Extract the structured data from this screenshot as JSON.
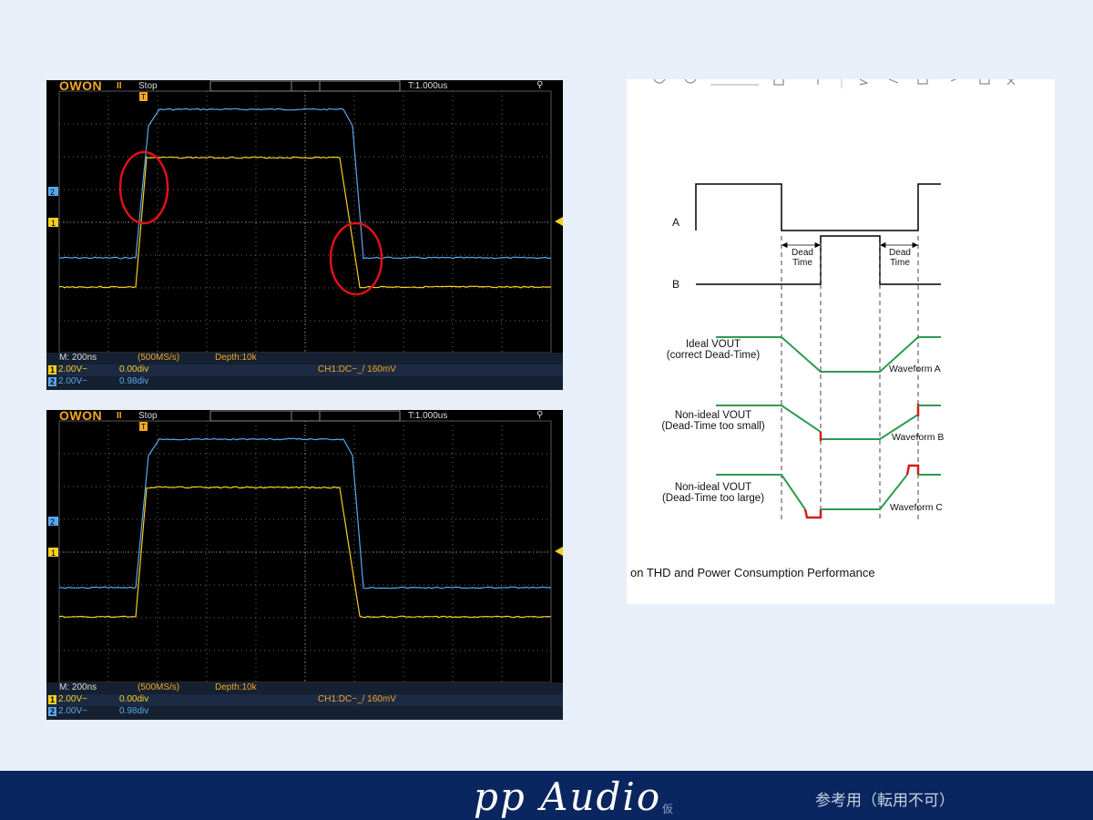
{
  "scopes": [
    {
      "brand": "OWON",
      "run_state": "Stop",
      "pause_glyph": "II",
      "trigger_time": "T:1.000us",
      "timebase": "M: 200ns",
      "sample_rate": "(500MS/s)",
      "depth": "Depth:10k",
      "trigger": "CH1:DC~_/ 160mV",
      "ch1": {
        "num": "1",
        "volts": "2.00V~",
        "offset": "0.00div",
        "color": "#f5d020"
      },
      "ch2": {
        "num": "2",
        "volts": "2.00V~",
        "offset": "0.98div",
        "color": "#5aa8ef"
      },
      "markers": {
        "ch2": "2",
        "ch1": "1",
        "trigger": "T"
      },
      "highlight_circles": true
    },
    {
      "brand": "OWON",
      "run_state": "Stop",
      "pause_glyph": "II",
      "trigger_time": "T:1.000us",
      "timebase": "M: 200ns",
      "sample_rate": "(500MS/s)",
      "depth": "Depth:10k",
      "trigger": "CH1:DC~_/ 160mV",
      "ch1": {
        "num": "1",
        "volts": "2.00V~",
        "offset": "0.00div",
        "color": "#f5d020"
      },
      "ch2": {
        "num": "2",
        "volts": "2.00V~",
        "offset": "0.98div",
        "color": "#5aa8ef"
      },
      "markers": {
        "ch2": "2",
        "ch1": "1",
        "trigger": "T"
      },
      "highlight_circles": false
    }
  ],
  "diagram": {
    "signal_a": "A",
    "signal_b": "B",
    "dead_time_1": [
      "Dead",
      "Time"
    ],
    "dead_time_2": [
      "Dead",
      "Time"
    ],
    "ideal_label": [
      "Ideal VOUT",
      "(correct Dead-Time)"
    ],
    "small_label": [
      "Non-ideal VOUT",
      "(Dead-Time too small)"
    ],
    "large_label": [
      "Non-ideal VOUT",
      "(Dead-Time too large)"
    ],
    "waveform_a": "Waveform A",
    "waveform_b": "Waveform B",
    "waveform_c": "Waveform C",
    "caption": "on THD and Power Consumption Performance",
    "colors": {
      "ideal": "#2e9b50",
      "error": "#d0201a"
    }
  },
  "footer": {
    "logo": "pp Audio",
    "tentative": "仮",
    "note": "参考用（転用不可）"
  }
}
